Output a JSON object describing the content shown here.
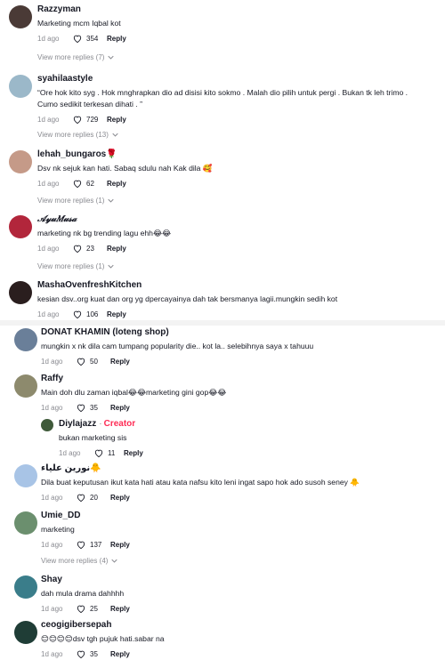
{
  "comments": [
    {
      "user": "Razzyman",
      "text": "Marketing mcm Iqbal kot",
      "time": "1d ago",
      "likes": "354",
      "reply": "Reply",
      "more": "View more replies (7)",
      "avatar_color": "#4a3a36"
    },
    {
      "user": "syahilaastyle",
      "text": "“Ore hok kito syg . Hok mnghrapkan dio ad disisi kito sokmo . Malah dio pilih untuk pergi . Bukan tk leh trimo . Cumo sedikit terkesan dihati . ”",
      "time": "1d ago",
      "likes": "729",
      "reply": "Reply",
      "more": "View more replies (13)",
      "avatar_color": "#9bb8c9"
    },
    {
      "user": "lehah_bungaros🌹",
      "text": "Dsv nk sejuk kan hati. Sabaq sdulu nah Kak dila 🥰",
      "time": "1d ago",
      "likes": "62",
      "reply": "Reply",
      "more": "View more replies (1)",
      "avatar_color": "#c59a88"
    },
    {
      "user": "𝒜𝓎𝓊𝑀𝓊𝓈𝒶",
      "text": "marketing nk bg trending lagu ehh😂😂",
      "time": "1d ago",
      "likes": "23",
      "reply": "Reply",
      "more": "View more replies (1)",
      "avatar_color": "#b2263b"
    },
    {
      "user": "MashaOvenfreshKitchen",
      "text": "kesian dsv..org kuat dan org yg dpercayainya dah tak bersmanya lagii.mungkin sedih kot",
      "time": "1d ago",
      "likes": "106",
      "reply": "Reply",
      "avatar_color": "#2a1e1e"
    },
    {
      "user": "DONAT KHAMIN (loteng shop)",
      "text": "mungkin x nk dila cam tumpang popularity die.. kot la.. selebihnya saya x tahuuu",
      "time": "1d ago",
      "likes": "50",
      "reply": "Reply",
      "avatar_color": "#6a7f99"
    },
    {
      "user": "Raffy",
      "text": "Main doh dlu zaman iqbal😂😂marketing gini gop😂😂",
      "time": "1d ago",
      "likes": "35",
      "reply": "Reply",
      "avatar_color": "#8d8a6d"
    },
    {
      "user": "Diylajazz",
      "creator": "Creator",
      "text": "bukan marketing sis",
      "time": "1d ago",
      "likes": "11",
      "reply": "Reply",
      "avatar_color": "#3f5a3a"
    },
    {
      "user": "نورين علياء🐥",
      "text": "Dila buat keputusan ikut kata hati atau kata nafsu kito leni ingat sapo hok ado susoh seney 🐥",
      "time": "1d ago",
      "likes": "20",
      "reply": "Reply",
      "avatar_color": "#a8c4e6"
    },
    {
      "user": "Umie_DD",
      "text": "marketing",
      "time": "1d ago",
      "likes": "137",
      "reply": "Reply",
      "more": "View more replies (4)",
      "avatar_color": "#6b8f6e"
    },
    {
      "user": "Shay",
      "text": "dah mula drama dahhhh",
      "time": "1d ago",
      "likes": "25",
      "reply": "Reply",
      "avatar_color": "#3a7d8a"
    },
    {
      "user": "ceogigibersepah",
      "text": "😊😊😊😊dsv tgh pujuk hati.sabar na",
      "time": "1d ago",
      "likes": "35",
      "reply": "Reply",
      "avatar_color": "#1f3d36"
    }
  ]
}
